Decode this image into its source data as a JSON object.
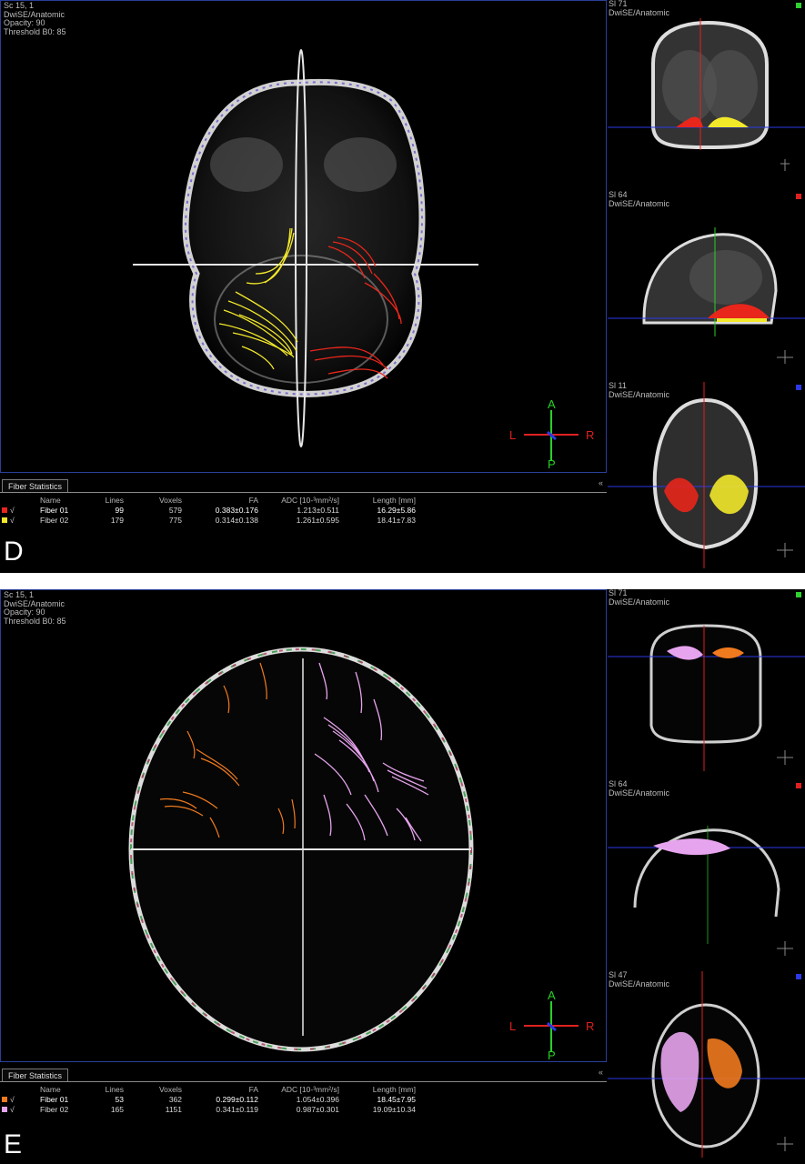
{
  "panels": [
    {
      "letter": "D",
      "overlay": [
        "Sc 15, 1",
        "DwiSE/Anatomic",
        "Opacity: 90",
        "Threshold B0: 85"
      ],
      "orientation": {
        "top": "A",
        "left": "L",
        "right": "R",
        "bottom": "P"
      },
      "side_views": [
        {
          "label": [
            "Sl 71",
            "DwiSE/Anatomic"
          ],
          "dot_color": "#2fd02f"
        },
        {
          "label": [
            "Sl 64",
            "DwiSE/Anatomic"
          ],
          "dot_color": "#e02020"
        },
        {
          "label": [
            "Sl 11",
            "DwiSE/Anatomic"
          ],
          "dot_color": "#2b39e6"
        }
      ],
      "stats": {
        "tab": "Fiber Statistics",
        "headers": [
          "Name",
          "Lines",
          "Voxels",
          "FA",
          "ADC  [10-³mm²/s]",
          "Length [mm]"
        ],
        "rows": [
          {
            "check": "√",
            "color": "#e8261b",
            "name": "Fiber 01",
            "lines": "99",
            "voxels": "579",
            "fa": "0.383±0.176",
            "adc": "1.213±0.511",
            "length": "16.29±5.86"
          },
          {
            "check": "√",
            "color": "#f2e82a",
            "name": "Fiber 02",
            "lines": "179",
            "voxels": "775",
            "fa": "0.314±0.138",
            "adc": "1.261±0.595",
            "length": "18.41±7.83"
          }
        ]
      }
    },
    {
      "letter": "E",
      "overlay": [
        "Sc 15, 1",
        "DwiSE/Anatomic",
        "Opacity: 90",
        "Threshold B0: 85"
      ],
      "orientation": {
        "top": "A",
        "left": "L",
        "right": "R",
        "bottom": "P"
      },
      "side_views": [
        {
          "label": [
            "Sl 71",
            "DwiSE/Anatomic"
          ],
          "dot_color": "#2fd02f"
        },
        {
          "label": [
            "Sl 64",
            "DwiSE/Anatomic"
          ],
          "dot_color": "#e02020"
        },
        {
          "label": [
            "Sl 47",
            "DwiSE/Anatomic"
          ],
          "dot_color": "#2b39e6"
        }
      ],
      "stats": {
        "tab": "Fiber Statistics",
        "headers": [
          "Name",
          "Lines",
          "Voxels",
          "FA",
          "ADC  [10-³mm²/s]",
          "Length [mm]"
        ],
        "rows": [
          {
            "check": "√",
            "color": "#f07a1e",
            "name": "Fiber 01",
            "lines": "53",
            "voxels": "362",
            "fa": "0.299±0.112",
            "adc": "1.054±0.396",
            "length": "18.45±7.95"
          },
          {
            "check": "√",
            "color": "#e7a4ee",
            "name": "Fiber 02",
            "lines": "165",
            "voxels": "1151",
            "fa": "0.341±0.119",
            "adc": "0.987±0.301",
            "length": "19.09±10.34"
          }
        ]
      }
    }
  ]
}
